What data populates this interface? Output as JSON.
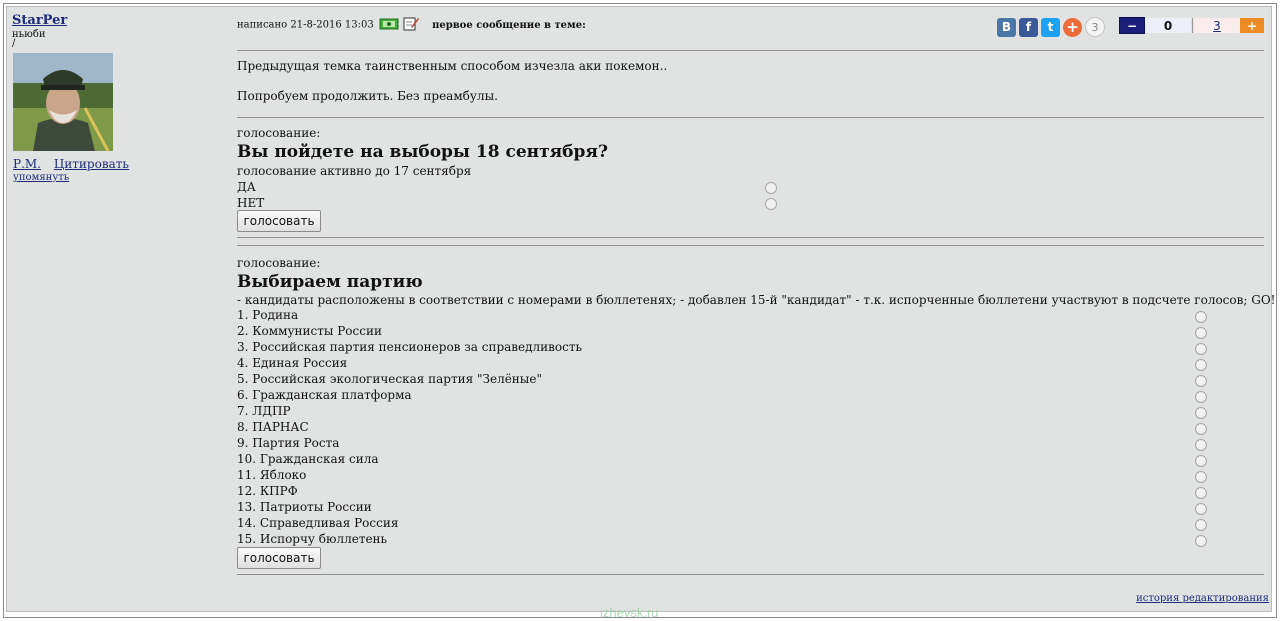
{
  "user": {
    "name": "StarPer",
    "status": "ньюби",
    "slash": "/",
    "link_pm": "Р.М.",
    "link_quote": "Цитировать",
    "link_mention": "упомянуть"
  },
  "post": {
    "written": "написано 21-8-2016 13:03",
    "first_msg": "первое сообщение в теме:",
    "share": {
      "vk": "B",
      "fb": "f",
      "tw": "t",
      "plus": "+",
      "count": "3"
    },
    "rating": {
      "minus": "−",
      "down": "0",
      "up": "3",
      "plus": "+"
    },
    "line1": "Предыдущая темка таинственным способом изчезла аки покемон..",
    "line2": "Попробуем продолжить. Без преамбулы."
  },
  "poll1": {
    "label": "голосование:",
    "title": "Вы пойдете на выборы 18 сентября?",
    "note": "голосование активно до 17 сентября",
    "options": [
      "ДА",
      "НЕТ"
    ],
    "button": "голосовать"
  },
  "poll2": {
    "label": "голосование:",
    "title": "Выбираем партию",
    "note": "- кандидаты расположены в соответствии с номерами в бюллетенях; - добавлен 15-й \"кандидат\" - т.к. испорченные бюллетени участвуют в подсчете голосов; GO!",
    "options": [
      "1. Родина",
      "2. Коммунисты России",
      "3. Российская партия пенсионеров за справедливость",
      "4. Единая Россия",
      "5. Российская экологическая партия \"Зелёные\"",
      "6. Гражданская платформа",
      "7. ЛДПР",
      "8. ПАРНАС",
      "9. Партия Роста",
      "10. Гражданская сила",
      "11. Яблоко",
      "12. КПРФ",
      "13. Патриоты России",
      "14. Справедливая Россия",
      "15. Испорчу бюллетень"
    ],
    "button": "голосовать"
  },
  "footer": {
    "history": "история редактирования",
    "watermark": "izhevsk.ru"
  },
  "colors": {
    "panel": "#e1e3e3",
    "link": "#1c2b7a",
    "vk": "#4a76a8",
    "fb": "#3b5998",
    "tw": "#1da1f2",
    "plus": "#ec6b3a",
    "rating_minus": "#1a1f7a",
    "rating_plus": "#ee8b24"
  }
}
